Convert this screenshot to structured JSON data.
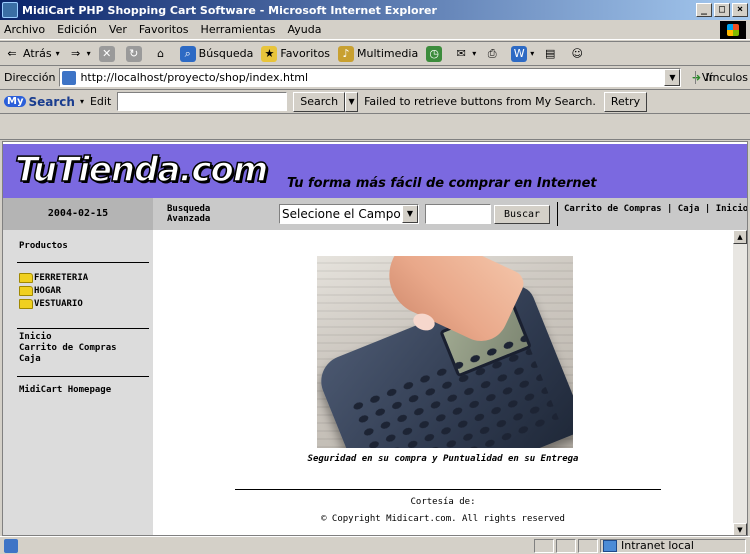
{
  "window": {
    "title": "MidiCart PHP Shopping Cart Software - Microsoft Internet Explorer",
    "min_label": "_",
    "max_label": "□",
    "close_label": "×"
  },
  "menu": [
    "Archivo",
    "Edición",
    "Ver",
    "Favoritos",
    "Herramientas",
    "Ayuda"
  ],
  "toolbar": {
    "back": "Atrás",
    "search": "Búsqueda",
    "favorites": "Favoritos",
    "multimedia": "Multimedia"
  },
  "address": {
    "label": "Dirección",
    "url": "http://localhost/proyecto/shop/index.html",
    "go": "Ir",
    "links": "Vínculos"
  },
  "mysearch": {
    "logo_my": "My",
    "logo_text": "Search",
    "edit": "Edit",
    "search_button": "Search",
    "message": "Failed to retrieve buttons from My Search.",
    "retry": "Retry"
  },
  "site": {
    "logo": "TuTienda.com",
    "slogan": "Tu forma más fácil de comprar en Internet",
    "date": "2004-02-15",
    "advanced_search": "Busqueda Avanzada",
    "field_select": "Selecione el Campo",
    "search_button": "Buscar",
    "top_links": "Carrito de Compras | Caja | Inicio",
    "sidebar": {
      "heading": "Productos",
      "categories": [
        "FERRETERIA",
        "HOGAR",
        "VESTUARIO"
      ],
      "links": [
        "Inicio",
        "Carrito de Compras",
        "Caja"
      ],
      "homepage": "MidiCart Homepage"
    },
    "caption": "Seguridad en su compra y Puntualidad en su Entrega",
    "footer_courtesy": "Cortesía de:",
    "footer_copyright": "© Copyright Midicart.com. All rights reserved"
  },
  "status": {
    "zone": "Intranet local"
  },
  "colors": {
    "banner": "#7b69e0",
    "sidebar": "#dcdcdc",
    "nav_strip": "#c9c9c9"
  }
}
